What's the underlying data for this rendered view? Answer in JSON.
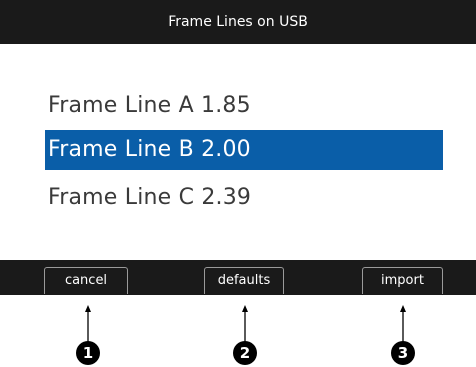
{
  "header": {
    "title": "Frame Lines on USB"
  },
  "list": {
    "items": [
      {
        "label": "Frame Line A 1.85",
        "selected": false
      },
      {
        "label": "Frame Line B 2.00",
        "selected": true
      },
      {
        "label": "Frame Line C 2.39",
        "selected": false
      }
    ]
  },
  "softkeys": {
    "cancel_label": "cancel",
    "defaults_label": "defaults",
    "import_label": "import"
  },
  "callouts": [
    "1",
    "2",
    "3"
  ],
  "colors": {
    "bar_background": "#1a1a1a",
    "selection": "#0a5ea8",
    "text": "#3a3a3a"
  }
}
